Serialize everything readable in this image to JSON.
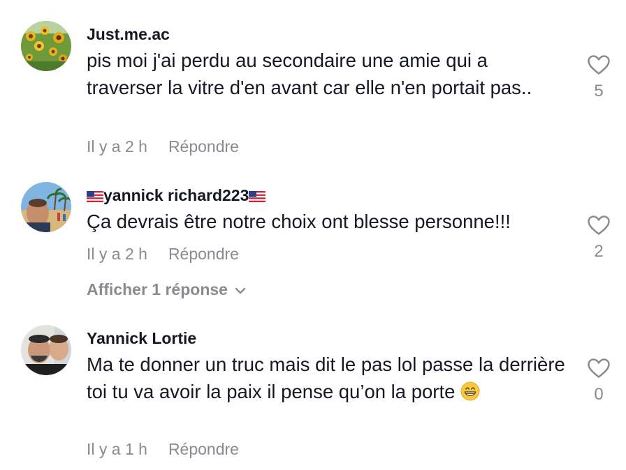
{
  "comments": [
    {
      "username": "Just.me.ac",
      "text": "pis moi j'ai perdu au secondaire une amie qui a traverser la vitre d'en avant car elle n'en portait pas..",
      "time": "Il y a 2 h",
      "reply_label": "Répondre",
      "likes": "5",
      "avatar_icon": "sunflower-avatar"
    },
    {
      "username": "yannick richard223",
      "username_flags": "us-flag-icon",
      "text": "Ça devrais être notre choix ont blesse personne!!!",
      "time": "Il y a 2 h",
      "reply_label": "Répondre",
      "likes": "2",
      "view_replies": "Afficher 1 réponse",
      "avatar_icon": "beach-selfie-avatar"
    },
    {
      "username": "Yannick Lortie",
      "text": "Ma te donner un truc mais dit le pas lol passe la derrière toi tu va avoir la paix il pense qu’on la porte",
      "emoji": "grinning-face-emoji",
      "time": "Il y a 1 h",
      "reply_label": "Répondre",
      "likes": "0",
      "avatar_icon": "couple-selfie-avatar"
    }
  ],
  "colors": {
    "primary_text": "#161823",
    "secondary_text": "#8a8b91",
    "background": "#ffffff"
  }
}
